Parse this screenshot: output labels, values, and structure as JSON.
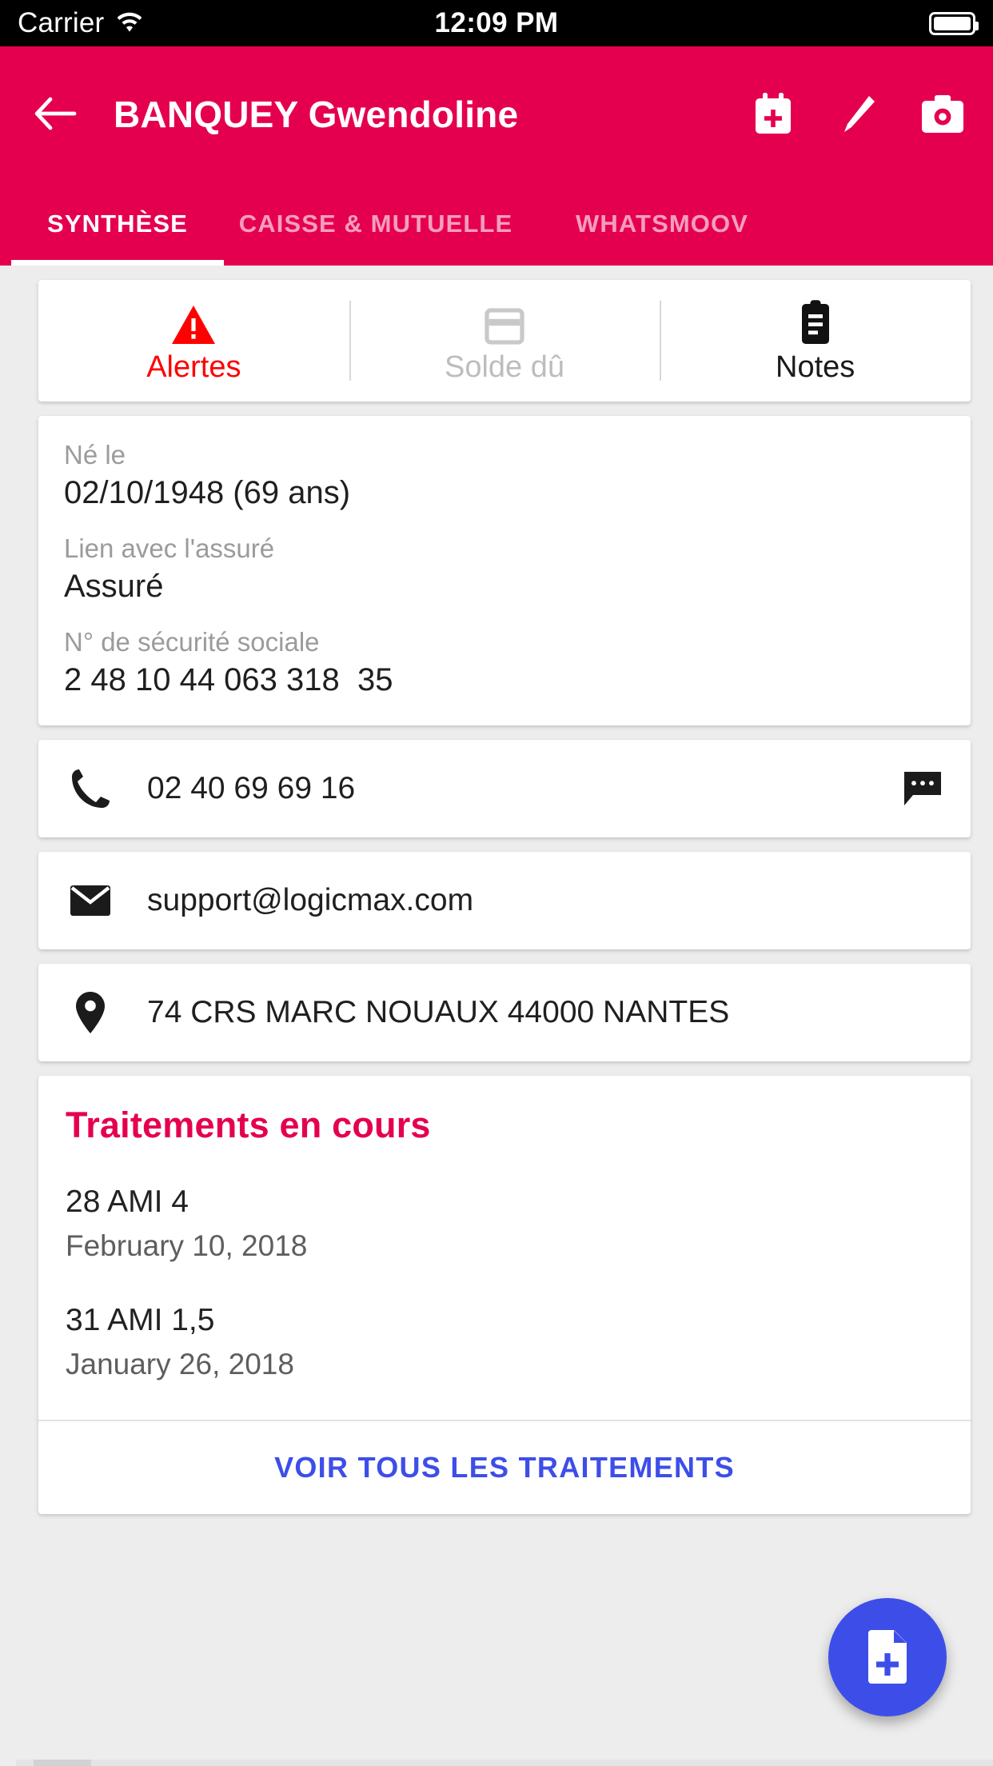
{
  "statusbar": {
    "carrier": "Carrier",
    "time": "12:09 PM",
    "wifi_icon": "wifi-icon",
    "battery_icon": "battery-full-icon"
  },
  "appbar": {
    "back_icon": "arrow-left-icon",
    "title": "BANQUEY Gwendoline",
    "actions": [
      {
        "icon": "calendar-plus-icon",
        "name": "add-appointment-button"
      },
      {
        "icon": "pencil-icon",
        "name": "edit-button"
      },
      {
        "icon": "camera-icon",
        "name": "camera-button"
      }
    ]
  },
  "tabs": [
    {
      "label": "SYNTHÈSE",
      "active": true
    },
    {
      "label": "CAISSE & MUTUELLE",
      "active": false
    },
    {
      "label": "WHATSMOOV",
      "active": false
    }
  ],
  "quick_actions": [
    {
      "label": "Alertes",
      "icon": "warning-triangle-icon",
      "color": "#ff0000"
    },
    {
      "label": "Solde dû",
      "icon": "credit-card-icon",
      "color": "#bdbdbd"
    },
    {
      "label": "Notes",
      "icon": "clipboard-icon",
      "color": "#1a1a1a"
    }
  ],
  "patient_info": [
    {
      "label": "Né le",
      "value": "02/10/1948 (69 ans)"
    },
    {
      "label": "Lien avec l'assuré",
      "value": "Assuré"
    },
    {
      "label": "N° de sécurité sociale",
      "value": "2 48 10 44 063 318  35"
    }
  ],
  "contacts": [
    {
      "icon": "phone-icon",
      "text": "02 40 69 69 16",
      "trailing_icon": "chat-bubble-icon"
    },
    {
      "icon": "envelope-icon",
      "text": "support@logicmax.com",
      "trailing_icon": null
    },
    {
      "icon": "map-pin-icon",
      "text": "74 CRS MARC NOUAUX 44000 NANTES",
      "trailing_icon": null
    }
  ],
  "treatments": {
    "title": "Traitements en cours",
    "items": [
      {
        "name": "28 AMI 4",
        "date": "February 10, 2018"
      },
      {
        "name": "31 AMI 1,5",
        "date": "January 26, 2018"
      }
    ],
    "see_all_label": "VOIR TOUS LES TRAITEMENTS"
  },
  "fab": {
    "icon": "document-plus-icon",
    "color": "#3d4ee8"
  },
  "colors": {
    "brand_pink": "#e5004f",
    "accent_blue": "#3d4ee8",
    "alert_red": "#ff0000",
    "muted_gray": "#9b9b9b"
  }
}
